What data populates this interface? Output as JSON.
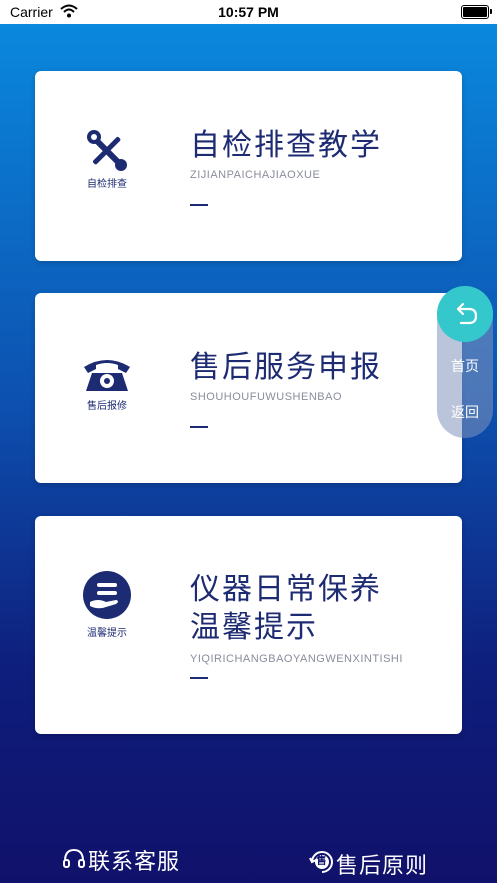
{
  "status_bar": {
    "carrier": "Carrier",
    "time": "10:57 PM"
  },
  "cards": [
    {
      "icon": "tools-icon",
      "icon_label": "自检排查",
      "title": "自检排查教学",
      "subtitle": "ZIJIANPAICHAJIAOXUE"
    },
    {
      "icon": "telephone-icon",
      "icon_label": "售后报修",
      "title": "售后服务申报",
      "subtitle": "SHOUHOUFUWUSHENBAO"
    },
    {
      "icon": "hand-care-icon",
      "icon_label": "温馨提示",
      "title_line1": "仪器日常保养",
      "title_line2": "温馨提示",
      "subtitle": "YIQIRICHANGBAOYANGWENXINTISHI"
    }
  ],
  "side_panel": {
    "home_label": "首页",
    "back_label": "返回",
    "accent": "#34c8cc"
  },
  "bottom_bar": {
    "contact_label": "联系客服",
    "after_sales_label": "售后原则",
    "badge_char": "售"
  },
  "colors": {
    "primary": "#1d2b73",
    "bg_top": "#0a88dd",
    "bg_bottom": "#10116a"
  }
}
